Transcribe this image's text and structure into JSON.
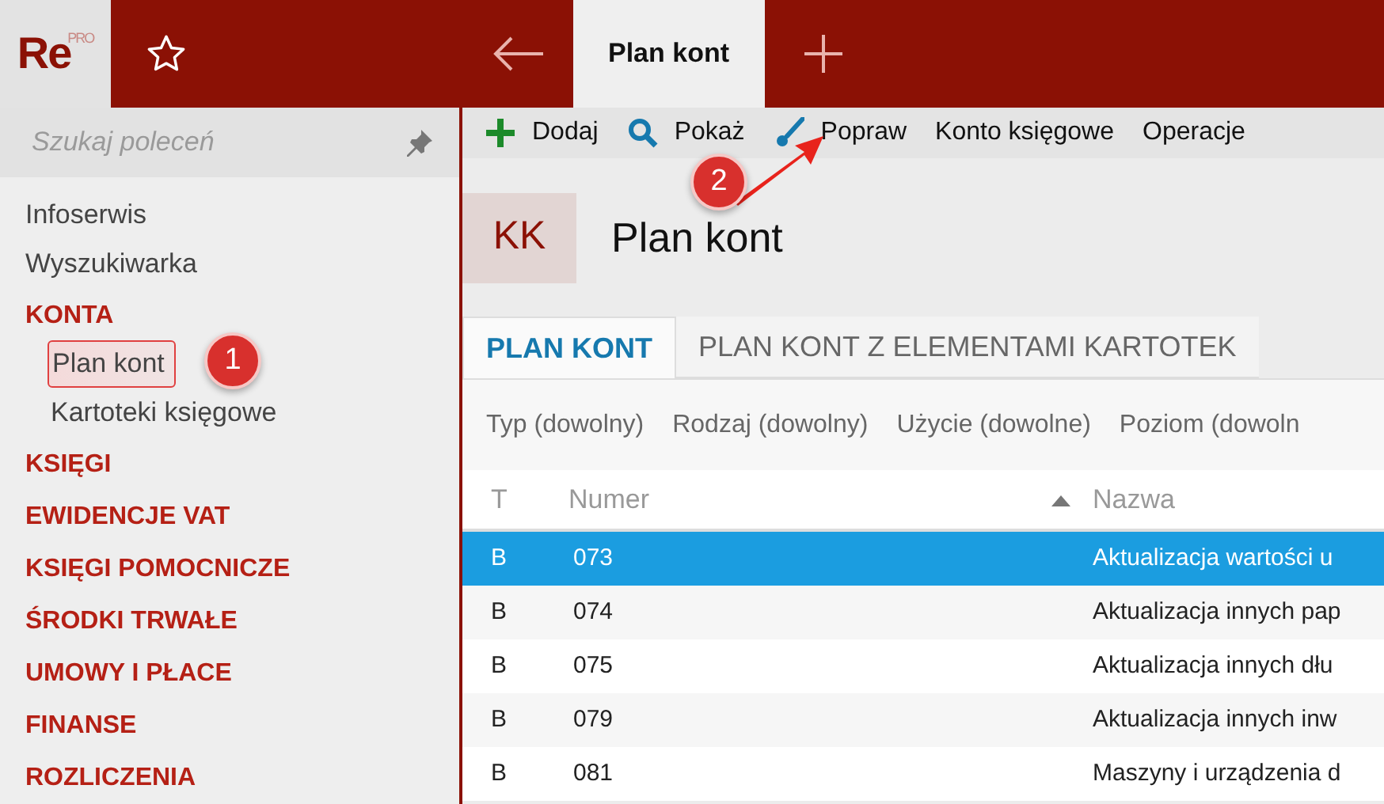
{
  "logo": {
    "text": "Re",
    "superscript": "PRO"
  },
  "app_tabs": [
    {
      "label": "Plan kont",
      "selected": true
    }
  ],
  "sidebar": {
    "search": {
      "placeholder": "Szukaj poleceń"
    },
    "items": [
      {
        "label": "Infoserwis",
        "kind": "link",
        "selected": false
      },
      {
        "label": "Wyszukiwarka",
        "kind": "link",
        "selected": false
      },
      {
        "label": "KONTA",
        "kind": "section",
        "selected": false,
        "children": [
          {
            "label": "Plan kont",
            "kind": "link",
            "selected": true
          },
          {
            "label": "Kartoteki księgowe",
            "kind": "link",
            "selected": false
          }
        ]
      },
      {
        "label": "KSIĘGI",
        "kind": "section",
        "selected": false
      },
      {
        "label": "EWIDENCJE VAT",
        "kind": "section",
        "selected": false
      },
      {
        "label": "KSIĘGI POMOCNICZE",
        "kind": "section",
        "selected": false
      },
      {
        "label": "ŚRODKI TRWAŁE",
        "kind": "section",
        "selected": false
      },
      {
        "label": "UMOWY I PŁACE",
        "kind": "section",
        "selected": false
      },
      {
        "label": "FINANSE",
        "kind": "section",
        "selected": false
      },
      {
        "label": "ROZLICZENIA",
        "kind": "section",
        "selected": false
      }
    ]
  },
  "toolbar": [
    {
      "label": "Dodaj",
      "kind": "plus"
    },
    {
      "label": "Pokaż",
      "kind": "search"
    },
    {
      "label": "Popraw",
      "kind": "brush"
    },
    {
      "label": "Konto księgowe",
      "kind": "none"
    },
    {
      "label": "Operacje",
      "kind": "none"
    }
  ],
  "header": {
    "badge": "KK",
    "title": "Plan kont"
  },
  "tabs": [
    {
      "label": "PLAN KONT",
      "selected": true
    },
    {
      "label": "PLAN KONT Z ELEMENTAMI KARTOTEK",
      "selected": false
    }
  ],
  "filters": [
    "Typ (dowolny)",
    "Rodzaj (dowolny)",
    "Użycie (dowolne)",
    "Poziom (dowoln"
  ],
  "table": {
    "columns": [
      {
        "label": "T",
        "sorted": false
      },
      {
        "label": "Numer",
        "sorted": true
      },
      {
        "label": "Nazwa",
        "sorted": false
      }
    ],
    "rows": [
      {
        "cells": [
          "B",
          "073",
          "Aktualizacja wartości u"
        ],
        "selected": true
      },
      {
        "cells": [
          "B",
          "074",
          "Aktualizacja innych pap"
        ],
        "selected": false
      },
      {
        "cells": [
          "B",
          "075",
          "Aktualizacja innych dłu"
        ],
        "selected": false
      },
      {
        "cells": [
          "B",
          "079",
          "Aktualizacja innych inw"
        ],
        "selected": false
      },
      {
        "cells": [
          "B",
          "081",
          "Maszyny i urządzenia d"
        ],
        "selected": false
      }
    ]
  },
  "annotations": [
    {
      "label": "1"
    },
    {
      "label": "2"
    }
  ]
}
